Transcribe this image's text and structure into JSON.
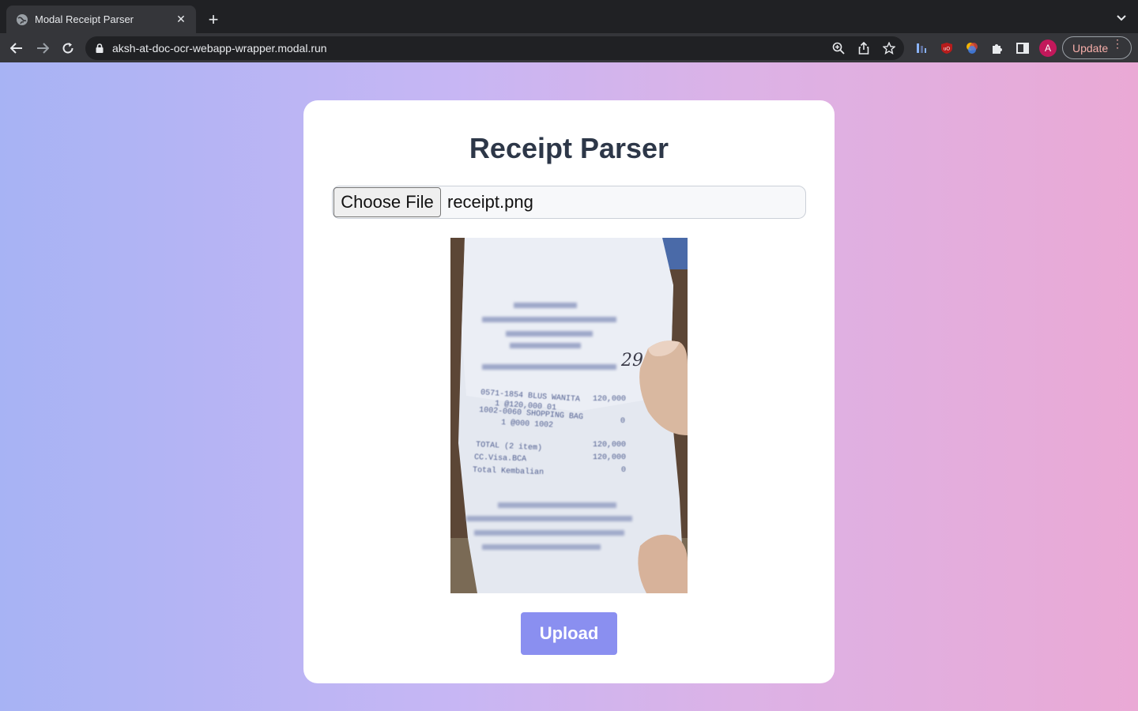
{
  "browser": {
    "tab_title": "Modal Receipt Parser",
    "url": "aksh-at-doc-ocr-webapp-wrapper.modal.run",
    "profile_initial": "A",
    "update_label": "Update"
  },
  "page": {
    "title": "Receipt Parser",
    "file_input": {
      "button_label": "Choose File",
      "file_name": "receipt.png"
    },
    "upload_label": "Upload",
    "receipt_image": {
      "handwritten": "29",
      "lines": [
        {
          "left": "0571-1854 BLUS WANITA",
          "right": ""
        },
        {
          "left": "1   @120,000  01",
          "right": "120,000"
        },
        {
          "left": "1002-0060 SHOPPING BAG",
          "right": ""
        },
        {
          "left": "1   @000 1002",
          "right": "0"
        },
        {
          "left": "TOTAL (2 item)",
          "right": "120,000"
        },
        {
          "left": "CC.Visa.BCA",
          "right": "120,000"
        },
        {
          "left": "Total Kembalian",
          "right": "0"
        }
      ]
    }
  },
  "colors": {
    "gradient_left": "#a7b3f4",
    "gradient_right": "#eaa9d5",
    "upload_button": "#8a8ff0",
    "title_text": "#2d3748"
  }
}
